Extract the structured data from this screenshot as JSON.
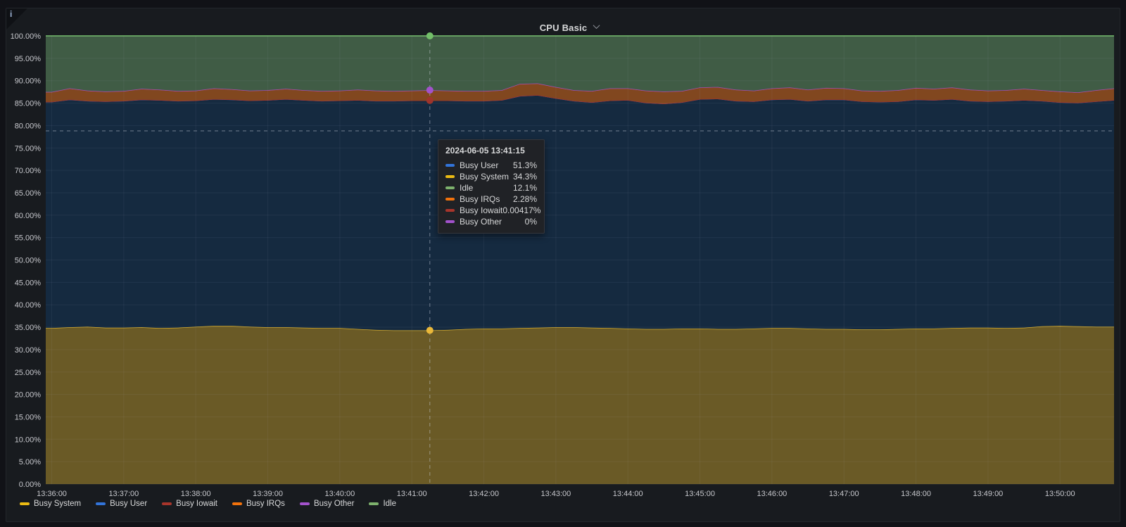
{
  "panel": {
    "title": "CPU Basic",
    "info_icon_glyph": "i"
  },
  "theme": {
    "page_bg": "#111217",
    "panel_bg": "#181b1f",
    "grid": "rgba(204,204,220,0.07)",
    "crosshair": "rgba(205,210,222,0.5)",
    "axis_text": "#c7c8cd"
  },
  "y_axis": {
    "ticks": [
      "0.00%",
      "5.00%",
      "10.00%",
      "15.00%",
      "20.00%",
      "25.00%",
      "30.00%",
      "35.00%",
      "40.00%",
      "45.00%",
      "50.00%",
      "55.00%",
      "60.00%",
      "65.00%",
      "70.00%",
      "75.00%",
      "80.00%",
      "85.00%",
      "90.00%",
      "95.00%",
      "100.00%"
    ]
  },
  "x_axis": {
    "ticks": [
      "13:36:00",
      "13:37:00",
      "13:38:00",
      "13:39:00",
      "13:40:00",
      "13:41:00",
      "13:42:00",
      "13:43:00",
      "13:44:00",
      "13:45:00",
      "13:46:00",
      "13:47:00",
      "13:48:00",
      "13:49:00",
      "13:50:00"
    ]
  },
  "legend": {
    "items": [
      {
        "label": "Busy System",
        "color": "#ECBB13"
      },
      {
        "label": "Busy User",
        "color": "#3274D9"
      },
      {
        "label": "Busy Iowait",
        "color": "#A8352B"
      },
      {
        "label": "Busy IRQs",
        "color": "#F2720C"
      },
      {
        "label": "Busy Other",
        "color": "#A352CC"
      },
      {
        "label": "Idle",
        "color": "#7EB26D"
      }
    ]
  },
  "tooltip": {
    "time": "2024-06-05 13:41:15",
    "rows": [
      {
        "label": "Busy User",
        "value": "51.3%",
        "color": "#3274D9"
      },
      {
        "label": "Busy System",
        "value": "34.3%",
        "color": "#ECBB13"
      },
      {
        "label": "Idle",
        "value": "12.1%",
        "color": "#7EB26D"
      },
      {
        "label": "Busy IRQs",
        "value": "2.28%",
        "color": "#F2720C"
      },
      {
        "label": "Busy Iowait",
        "value": "0.00417%",
        "color": "#A8352B"
      },
      {
        "label": "Busy Other",
        "value": "0%",
        "color": "#A352CC"
      }
    ]
  },
  "chart_data": {
    "type": "area",
    "stacking": "percent",
    "unit": "percent",
    "title": "CPU Basic",
    "y_range": [
      0,
      100
    ],
    "y_tick_step": 5,
    "grid": true,
    "legend_position": "bottom",
    "time_start": "13:36:00",
    "time_end": "13:50:45",
    "time_step_seconds": 15,
    "x_tick_labels": [
      "13:36:00",
      "13:37:00",
      "13:38:00",
      "13:39:00",
      "13:40:00",
      "13:41:00",
      "13:42:00",
      "13:43:00",
      "13:44:00",
      "13:45:00",
      "13:46:00",
      "13:47:00",
      "13:48:00",
      "13:49:00",
      "13:50:00"
    ],
    "series": [
      {
        "name": "Busy System",
        "swatch": "#ECBB13",
        "line": "#D9AE2C",
        "fill": "#6A5A26",
        "values": [
          34.8,
          35.0,
          35.1,
          34.9,
          34.9,
          35.0,
          34.8,
          34.9,
          35.1,
          35.3,
          35.3,
          35.1,
          35.0,
          35.0,
          34.9,
          34.8,
          34.8,
          34.6,
          34.4,
          34.3,
          34.3,
          34.3,
          34.4,
          34.6,
          34.7,
          34.7,
          34.8,
          34.9,
          35.0,
          35.0,
          34.9,
          34.8,
          34.7,
          34.6,
          34.6,
          34.7,
          34.7,
          34.6,
          34.6,
          34.7,
          34.8,
          34.8,
          34.7,
          34.6,
          34.6,
          34.5,
          34.5,
          34.6,
          34.7,
          34.7,
          34.8,
          34.9,
          34.9,
          34.8,
          34.9,
          35.2,
          35.3,
          35.2,
          35.1,
          35.1
        ]
      },
      {
        "name": "Busy User",
        "swatch": "#3274D9",
        "line": "#3A76D9",
        "fill": "#152A40",
        "values": [
          50.5,
          50.8,
          50.4,
          50.5,
          50.6,
          50.8,
          50.9,
          50.6,
          50.5,
          50.6,
          50.5,
          50.5,
          50.7,
          50.9,
          50.8,
          50.7,
          50.8,
          51.1,
          51.1,
          51.2,
          51.3,
          51.3,
          51.2,
          50.9,
          50.8,
          51.0,
          51.8,
          51.9,
          51.1,
          50.5,
          50.3,
          50.8,
          51.0,
          50.5,
          50.3,
          50.5,
          51.2,
          51.4,
          50.9,
          50.7,
          51.0,
          51.1,
          50.8,
          51.2,
          51.2,
          50.9,
          50.8,
          50.8,
          51.1,
          51.0,
          51.1,
          50.6,
          50.5,
          50.7,
          50.8,
          50.3,
          49.9,
          49.9,
          50.3,
          50.6
        ]
      },
      {
        "name": "Busy Iowait",
        "swatch": "#A8352B",
        "line": "#9E342C",
        "fill": "none",
        "values": [
          0.004,
          0.004,
          0.004,
          0.004,
          0.004,
          0.004,
          0.004,
          0.004,
          0.004,
          0.004,
          0.004,
          0.004,
          0.004,
          0.004,
          0.004,
          0.004,
          0.004,
          0.004,
          0.004,
          0.004,
          0.004,
          0.004,
          0.004,
          0.004,
          0.004,
          0.004,
          0.004,
          0.004,
          0.004,
          0.004,
          0.004,
          0.004,
          0.004,
          0.004,
          0.004,
          0.004,
          0.004,
          0.004,
          0.004,
          0.004,
          0.004,
          0.004,
          0.004,
          0.004,
          0.004,
          0.004,
          0.004,
          0.004,
          0.004,
          0.004,
          0.004,
          0.004,
          0.004,
          0.004,
          0.004,
          0.004,
          0.004,
          0.004,
          0.004,
          0.004
        ]
      },
      {
        "name": "Busy IRQs",
        "swatch": "#F2720C",
        "line": "#C9661A",
        "fill": "#81471F",
        "values": [
          2.2,
          2.5,
          2.3,
          2.2,
          2.2,
          2.4,
          2.3,
          2.2,
          2.2,
          2.4,
          2.3,
          2.2,
          2.2,
          2.3,
          2.2,
          2.2,
          2.2,
          2.3,
          2.3,
          2.2,
          2.2,
          2.3,
          2.2,
          2.2,
          2.2,
          2.2,
          2.7,
          2.6,
          2.5,
          2.4,
          2.5,
          2.7,
          2.6,
          2.7,
          2.7,
          2.5,
          2.6,
          2.6,
          2.5,
          2.4,
          2.5,
          2.6,
          2.5,
          2.6,
          2.5,
          2.4,
          2.4,
          2.5,
          2.6,
          2.5,
          2.6,
          2.5,
          2.4,
          2.4,
          2.5,
          2.4,
          2.4,
          2.3,
          2.5,
          2.6
        ]
      },
      {
        "name": "Busy Other",
        "swatch": "#A352CC",
        "line": "#9E4BB8",
        "fill": "none",
        "values": [
          0,
          0,
          0,
          0,
          0,
          0,
          0,
          0,
          0,
          0,
          0,
          0,
          0,
          0,
          0,
          0,
          0,
          0,
          0,
          0,
          0,
          0,
          0,
          0,
          0,
          0,
          0,
          0,
          0,
          0,
          0,
          0,
          0,
          0,
          0,
          0,
          0,
          0,
          0,
          0,
          0,
          0,
          0,
          0,
          0,
          0,
          0,
          0,
          0,
          0,
          0,
          0,
          0,
          0,
          0,
          0,
          0,
          0,
          0,
          0
        ]
      },
      {
        "name": "Idle",
        "swatch": "#7EB26D",
        "line": "#73BF69",
        "fill": "#405C45",
        "values": [
          12.5,
          11.7,
          12.2,
          12.4,
          12.3,
          11.8,
          12.0,
          12.3,
          12.2,
          11.7,
          11.9,
          12.2,
          12.1,
          11.8,
          12.1,
          12.3,
          12.2,
          12.0,
          12.2,
          12.3,
          12.2,
          12.1,
          12.2,
          12.3,
          12.3,
          12.1,
          10.7,
          10.6,
          11.4,
          12.1,
          12.3,
          11.7,
          11.7,
          12.2,
          12.4,
          12.3,
          11.5,
          11.4,
          12.0,
          12.2,
          11.7,
          11.5,
          12.0,
          11.6,
          11.7,
          12.2,
          12.3,
          12.1,
          11.6,
          11.8,
          11.5,
          12.0,
          12.2,
          12.1,
          11.8,
          12.1,
          12.4,
          12.6,
          12.1,
          11.7
        ]
      }
    ],
    "crosshair": {
      "time": "13:41:15",
      "t_seconds": 315,
      "index": 21,
      "y_percent": 78.8,
      "markers": [
        {
          "series": "Busy System",
          "color": "#EAB839"
        },
        {
          "series": "Busy Iowait",
          "color": "#9E342C"
        },
        {
          "series": "Busy Other",
          "color": "#A352CC"
        },
        {
          "series": "Idle",
          "color": "#73BF69"
        }
      ]
    }
  }
}
